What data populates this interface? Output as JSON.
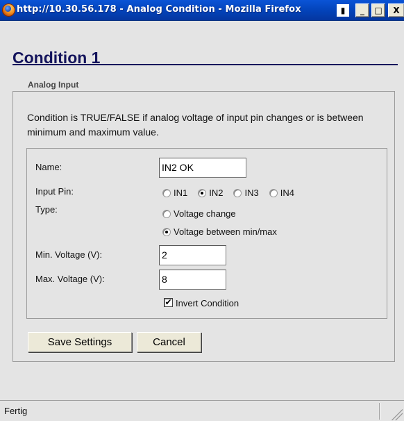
{
  "window": {
    "title": "http://10.30.56.178 - Analog Condition - Mozilla Firefox",
    "controls": {
      "minimize": "_",
      "maximize": "□",
      "close": "X"
    }
  },
  "page": {
    "heading": "Condition 1",
    "section_legend": "Analog Input",
    "description": "Condition is TRUE/FALSE if analog voltage of input pin changes or is between minimum and maximum value."
  },
  "form": {
    "name_label": "Name:",
    "name_value": "IN2 OK",
    "input_pin_label": "Input Pin:",
    "input_pins": [
      {
        "label": "IN1",
        "selected": false
      },
      {
        "label": "IN2",
        "selected": true
      },
      {
        "label": "IN3",
        "selected": false
      },
      {
        "label": "IN4",
        "selected": false
      }
    ],
    "type_label": "Type:",
    "types": [
      {
        "label": "Voltage change",
        "selected": false
      },
      {
        "label": "Voltage between min/max",
        "selected": true
      }
    ],
    "min_label": "Min. Voltage (V):",
    "min_value": "2",
    "max_label": "Max. Voltage (V):",
    "max_value": "8",
    "invert_label": "Invert Condition",
    "invert_checked": true
  },
  "buttons": {
    "save": "Save Settings",
    "cancel": "Cancel"
  },
  "status": {
    "text": "Fertig"
  }
}
